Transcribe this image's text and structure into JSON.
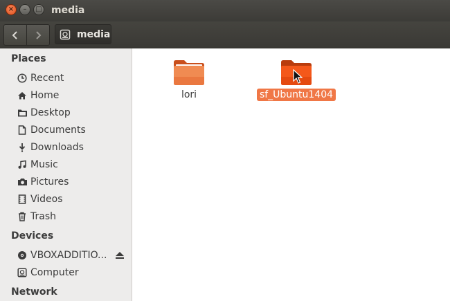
{
  "window": {
    "title": "media"
  },
  "window_controls": {
    "close": "×",
    "minimize": "–",
    "maximize": "□"
  },
  "toolbar": {
    "path_label": "media"
  },
  "sidebar": {
    "places_header": "Places",
    "places": [
      {
        "label": "Recent",
        "icon": "clock-icon"
      },
      {
        "label": "Home",
        "icon": "home-icon"
      },
      {
        "label": "Desktop",
        "icon": "desktop-folder-icon"
      },
      {
        "label": "Documents",
        "icon": "document-icon"
      },
      {
        "label": "Downloads",
        "icon": "download-icon"
      },
      {
        "label": "Music",
        "icon": "music-icon"
      },
      {
        "label": "Pictures",
        "icon": "camera-icon"
      },
      {
        "label": "Videos",
        "icon": "film-icon"
      },
      {
        "label": "Trash",
        "icon": "trash-icon"
      }
    ],
    "devices_header": "Devices",
    "devices": [
      {
        "label": "VBOXADDITIO...",
        "icon": "optical-disc-icon"
      },
      {
        "label": "Computer",
        "icon": "computer-drive-icon"
      }
    ],
    "network_header": "Network"
  },
  "files": [
    {
      "name": "lori",
      "selected": false
    },
    {
      "name": "sf_Ubuntu1404",
      "selected": true
    }
  ],
  "colors": {
    "folder_orange": "#f07746",
    "selection": "#f07746",
    "titlebar": "#3c3b37"
  }
}
